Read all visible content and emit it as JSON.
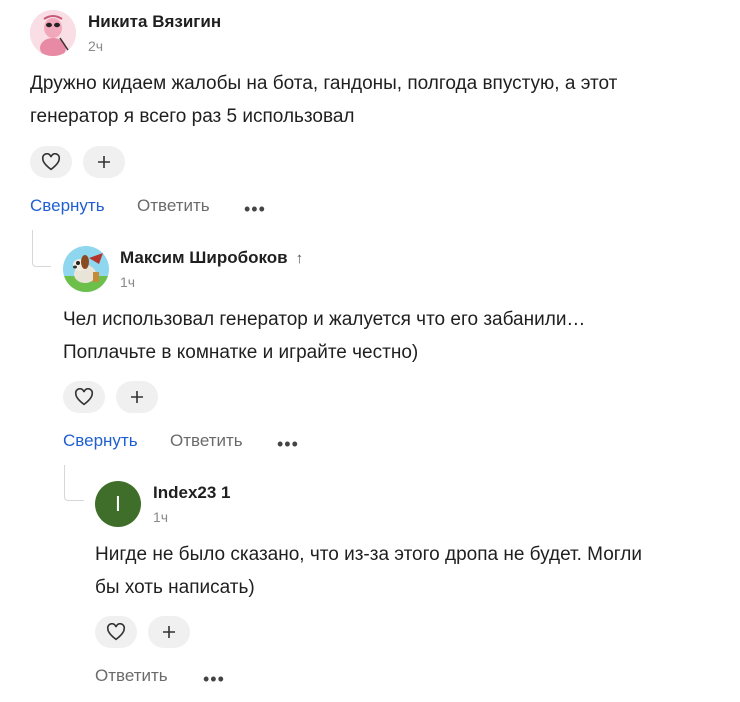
{
  "comments": [
    {
      "author": "Никита Вязигин",
      "time": "2ч",
      "text_lines": [
        "Дружно кидаем жалобы на бота, гандоны, полгода впустую, а этот",
        "генератор я всего раз 5 использовал"
      ],
      "avatar_icon": "pink-cartoon-avatar-icon",
      "actions": {
        "collapse": "Свернуть",
        "reply": "Ответить"
      }
    },
    {
      "author": "Максим Широбоков",
      "reply_arrow": "↑",
      "time": "1ч",
      "text_lines": [
        "Чел использовал генератор и жалуется что его забанили…",
        "Поплачьте в комнатке и играйте честно)"
      ],
      "avatar_icon": "dog-cartoon-avatar-icon",
      "actions": {
        "collapse": "Свернуть",
        "reply": "Ответить"
      }
    },
    {
      "author": "Index23 1",
      "time": "1ч",
      "avatar_letter": "I",
      "avatar_color": "#3f6e2a",
      "text_lines": [
        "Нигде не было сказано, что из-за этого дропа не будет. Могли",
        "бы хоть написать)"
      ],
      "actions": {
        "reply": "Ответить"
      }
    }
  ],
  "ui": {
    "like_icon": "heart-icon",
    "add_icon": "plus-icon",
    "more": "•••",
    "accent_color": "#1f5fd1"
  }
}
